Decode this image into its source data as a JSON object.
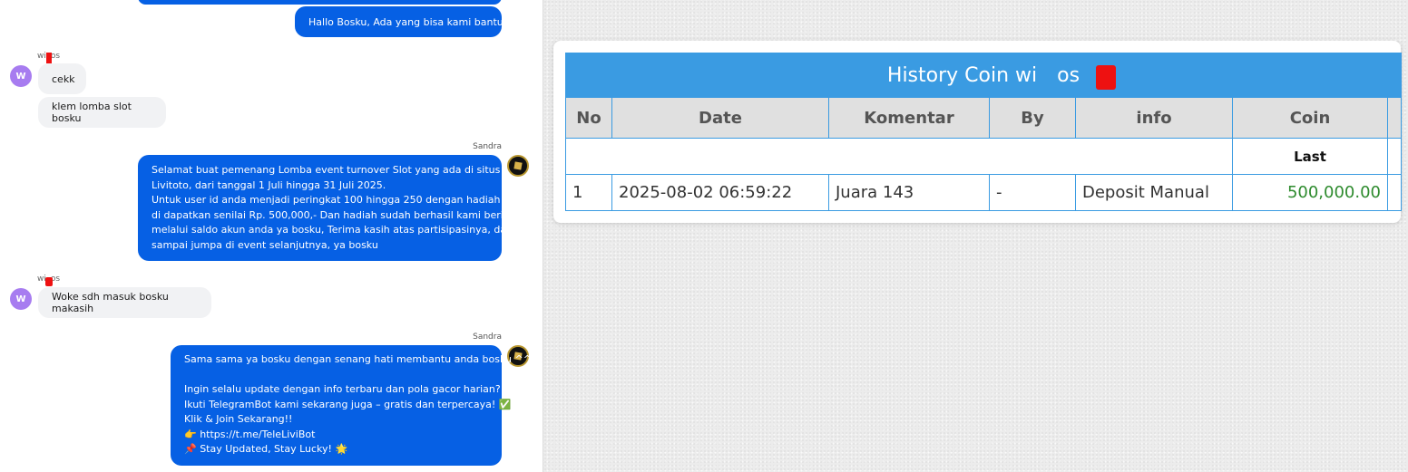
{
  "chat": {
    "agent_name": "Sandra",
    "user_name_prefix": "wi",
    "user_name_suffix": "os",
    "user_avatar_initial": "W",
    "messages": {
      "m1": "Hallo Bosku, Ada yang bisa kami bantu?",
      "m2": "cekk",
      "m3": "klem lomba slot bosku",
      "m4": [
        "Selamat buat pemenang Lomba event turnover Slot yang ada di situs",
        "Livitoto, dari tanggal 1 Juli hingga 31 Juli 2025.",
        "Untuk user id anda menjadi peringkat 100 hingga 250 dengan hadiah yang",
        "di dapatkan senilai Rp. 500,000,- Dan hadiah sudah berhasil kami berikan",
        "melalui saldo akun anda ya bosku, Terima kasih atas partisipasinya, dan",
        "sampai jumpa di event selanjutnya, ya bosku"
      ],
      "m5": "Woke sdh masuk bosku makasih",
      "m6": {
        "l1": "Sama sama ya bosku dengan senang hati membantu anda bosku ^^",
        "l2": "Ingin selalu update dengan info terbaru dan pola gacor harian?",
        "l3": "Ikuti TelegramBot kami sekarang juga – gratis dan terpercaya!",
        "l3_emoji": "✅",
        "l4": "Klik & Join Sekarang!!",
        "l5_emoji": "👉",
        "l5": "https://t.me/TeleLiviBot",
        "l6_emoji": "📌",
        "l6": "Stay Updated, Stay Lucky!",
        "l6_emoji_end": "🌟"
      }
    }
  },
  "history": {
    "title_prefix": "History Coin wi",
    "title_suffix": "os",
    "headers": [
      "No",
      "Date",
      "Komentar",
      "By",
      "info",
      "Coin"
    ],
    "last_label": "Last",
    "row": {
      "no": "1",
      "date": "2025-08-02 06:59:22",
      "komentar": "Juara 143",
      "by": "-",
      "info": "Deposit Manual",
      "coin": "500,000.00"
    }
  },
  "colors": {
    "agent_bubble": "#0660e4",
    "user_bubble": "#f1f2f4",
    "table_header_blue": "#3a9be2",
    "coin_green": "#2e8b2e",
    "redaction": "#ee1111"
  }
}
